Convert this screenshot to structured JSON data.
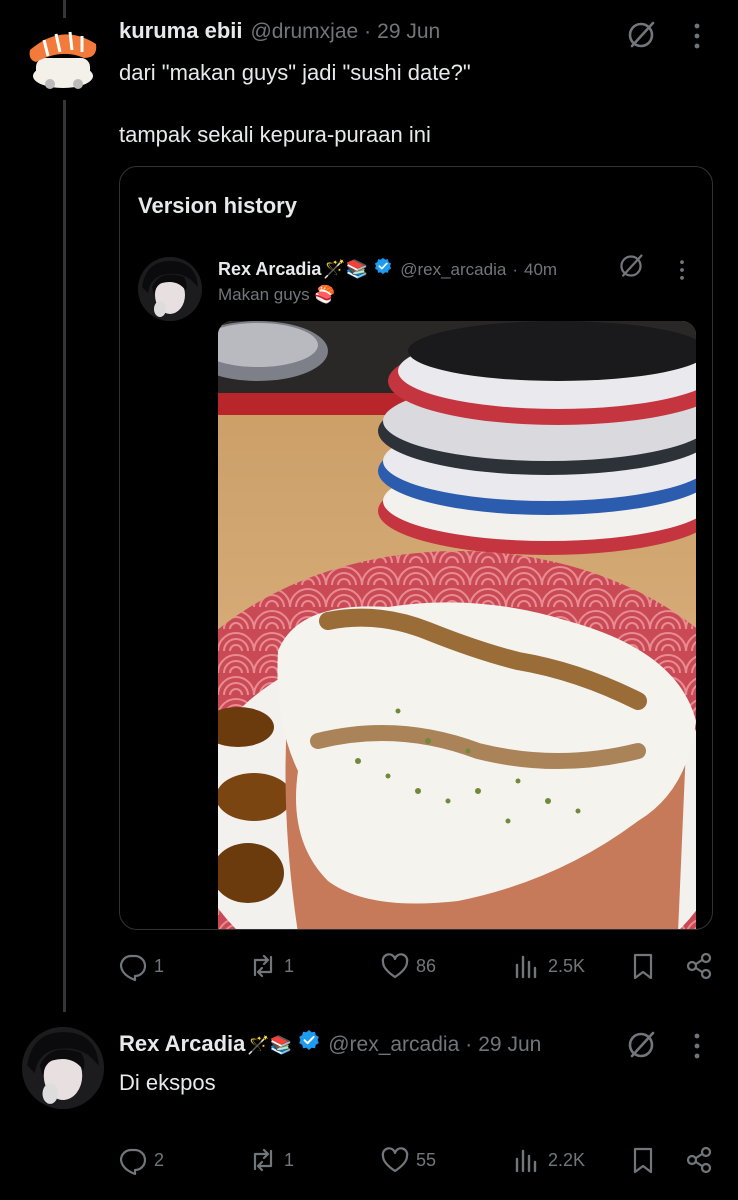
{
  "post1": {
    "name": "kuruma ebii",
    "handle": "@drumxjae",
    "separator": "·",
    "date": "29 Jun",
    "text_line1": "dari \"makan guys\" jadi \"sushi date?\"",
    "text_line2": "tampak sekali kepura-puraan ini",
    "quote": {
      "title": "Version history",
      "name": "Rex Arcadia",
      "name_emoji": "🪄📚",
      "handle": "@rex_arcadia",
      "separator": "·",
      "time": "40m",
      "text": "Makan guys",
      "text_emoji": "🍣"
    },
    "stats": {
      "replies": "1",
      "reposts": "1",
      "likes": "86",
      "views": "2.5K"
    }
  },
  "post2": {
    "name": "Rex Arcadia",
    "name_emoji": "🪄📚",
    "handle": "@rex_arcadia",
    "separator": "·",
    "date": "29 Jun",
    "text": "Di ekspos",
    "stats": {
      "replies": "2",
      "reposts": "1",
      "likes": "55",
      "views": "2.2K"
    }
  },
  "colors": {
    "background": "#000000",
    "text": "#e7e9ea",
    "muted": "#71767b",
    "verified": "#1d9bf0",
    "border": "#2f3336"
  },
  "icons": [
    "grok-icon",
    "more-icon",
    "reply-icon",
    "repost-icon",
    "like-icon",
    "views-icon",
    "bookmark-icon",
    "share-icon",
    "verified-badge-icon"
  ]
}
